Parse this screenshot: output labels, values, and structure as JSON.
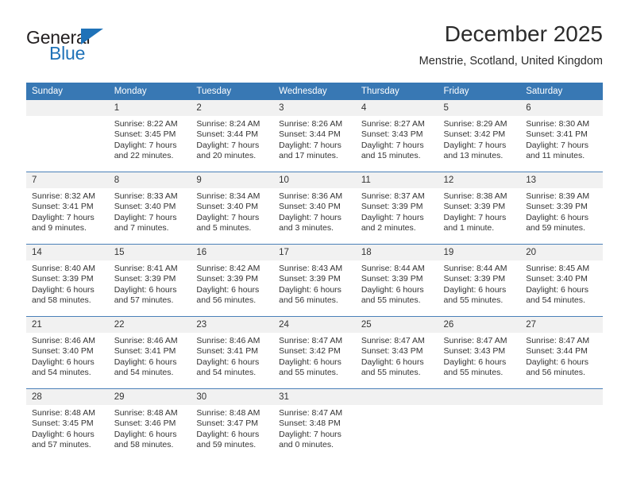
{
  "brand": {
    "name_top": "General",
    "name_bottom": "Blue",
    "triangle_icon": "triangle-icon",
    "accent_color": "#1f72b8",
    "dark_color": "#231f20"
  },
  "header": {
    "title": "December 2025",
    "subtitle": "Menstrie, Scotland, United Kingdom"
  },
  "calendar": {
    "header_bg": "#3878b4",
    "daynum_bg": "#f1f1f1",
    "weekday_headers": [
      "Sunday",
      "Monday",
      "Tuesday",
      "Wednesday",
      "Thursday",
      "Friday",
      "Saturday"
    ],
    "weeks": [
      [
        {
          "day": "",
          "lines": []
        },
        {
          "day": "1",
          "lines": [
            "Sunrise: 8:22 AM",
            "Sunset: 3:45 PM",
            "Daylight: 7 hours",
            "and 22 minutes."
          ]
        },
        {
          "day": "2",
          "lines": [
            "Sunrise: 8:24 AM",
            "Sunset: 3:44 PM",
            "Daylight: 7 hours",
            "and 20 minutes."
          ]
        },
        {
          "day": "3",
          "lines": [
            "Sunrise: 8:26 AM",
            "Sunset: 3:44 PM",
            "Daylight: 7 hours",
            "and 17 minutes."
          ]
        },
        {
          "day": "4",
          "lines": [
            "Sunrise: 8:27 AM",
            "Sunset: 3:43 PM",
            "Daylight: 7 hours",
            "and 15 minutes."
          ]
        },
        {
          "day": "5",
          "lines": [
            "Sunrise: 8:29 AM",
            "Sunset: 3:42 PM",
            "Daylight: 7 hours",
            "and 13 minutes."
          ]
        },
        {
          "day": "6",
          "lines": [
            "Sunrise: 8:30 AM",
            "Sunset: 3:41 PM",
            "Daylight: 7 hours",
            "and 11 minutes."
          ]
        }
      ],
      [
        {
          "day": "7",
          "lines": [
            "Sunrise: 8:32 AM",
            "Sunset: 3:41 PM",
            "Daylight: 7 hours",
            "and 9 minutes."
          ]
        },
        {
          "day": "8",
          "lines": [
            "Sunrise: 8:33 AM",
            "Sunset: 3:40 PM",
            "Daylight: 7 hours",
            "and 7 minutes."
          ]
        },
        {
          "day": "9",
          "lines": [
            "Sunrise: 8:34 AM",
            "Sunset: 3:40 PM",
            "Daylight: 7 hours",
            "and 5 minutes."
          ]
        },
        {
          "day": "10",
          "lines": [
            "Sunrise: 8:36 AM",
            "Sunset: 3:40 PM",
            "Daylight: 7 hours",
            "and 3 minutes."
          ]
        },
        {
          "day": "11",
          "lines": [
            "Sunrise: 8:37 AM",
            "Sunset: 3:39 PM",
            "Daylight: 7 hours",
            "and 2 minutes."
          ]
        },
        {
          "day": "12",
          "lines": [
            "Sunrise: 8:38 AM",
            "Sunset: 3:39 PM",
            "Daylight: 7 hours",
            "and 1 minute."
          ]
        },
        {
          "day": "13",
          "lines": [
            "Sunrise: 8:39 AM",
            "Sunset: 3:39 PM",
            "Daylight: 6 hours",
            "and 59 minutes."
          ]
        }
      ],
      [
        {
          "day": "14",
          "lines": [
            "Sunrise: 8:40 AM",
            "Sunset: 3:39 PM",
            "Daylight: 6 hours",
            "and 58 minutes."
          ]
        },
        {
          "day": "15",
          "lines": [
            "Sunrise: 8:41 AM",
            "Sunset: 3:39 PM",
            "Daylight: 6 hours",
            "and 57 minutes."
          ]
        },
        {
          "day": "16",
          "lines": [
            "Sunrise: 8:42 AM",
            "Sunset: 3:39 PM",
            "Daylight: 6 hours",
            "and 56 minutes."
          ]
        },
        {
          "day": "17",
          "lines": [
            "Sunrise: 8:43 AM",
            "Sunset: 3:39 PM",
            "Daylight: 6 hours",
            "and 56 minutes."
          ]
        },
        {
          "day": "18",
          "lines": [
            "Sunrise: 8:44 AM",
            "Sunset: 3:39 PM",
            "Daylight: 6 hours",
            "and 55 minutes."
          ]
        },
        {
          "day": "19",
          "lines": [
            "Sunrise: 8:44 AM",
            "Sunset: 3:39 PM",
            "Daylight: 6 hours",
            "and 55 minutes."
          ]
        },
        {
          "day": "20",
          "lines": [
            "Sunrise: 8:45 AM",
            "Sunset: 3:40 PM",
            "Daylight: 6 hours",
            "and 54 minutes."
          ]
        }
      ],
      [
        {
          "day": "21",
          "lines": [
            "Sunrise: 8:46 AM",
            "Sunset: 3:40 PM",
            "Daylight: 6 hours",
            "and 54 minutes."
          ]
        },
        {
          "day": "22",
          "lines": [
            "Sunrise: 8:46 AM",
            "Sunset: 3:41 PM",
            "Daylight: 6 hours",
            "and 54 minutes."
          ]
        },
        {
          "day": "23",
          "lines": [
            "Sunrise: 8:46 AM",
            "Sunset: 3:41 PM",
            "Daylight: 6 hours",
            "and 54 minutes."
          ]
        },
        {
          "day": "24",
          "lines": [
            "Sunrise: 8:47 AM",
            "Sunset: 3:42 PM",
            "Daylight: 6 hours",
            "and 55 minutes."
          ]
        },
        {
          "day": "25",
          "lines": [
            "Sunrise: 8:47 AM",
            "Sunset: 3:43 PM",
            "Daylight: 6 hours",
            "and 55 minutes."
          ]
        },
        {
          "day": "26",
          "lines": [
            "Sunrise: 8:47 AM",
            "Sunset: 3:43 PM",
            "Daylight: 6 hours",
            "and 55 minutes."
          ]
        },
        {
          "day": "27",
          "lines": [
            "Sunrise: 8:47 AM",
            "Sunset: 3:44 PM",
            "Daylight: 6 hours",
            "and 56 minutes."
          ]
        }
      ],
      [
        {
          "day": "28",
          "lines": [
            "Sunrise: 8:48 AM",
            "Sunset: 3:45 PM",
            "Daylight: 6 hours",
            "and 57 minutes."
          ]
        },
        {
          "day": "29",
          "lines": [
            "Sunrise: 8:48 AM",
            "Sunset: 3:46 PM",
            "Daylight: 6 hours",
            "and 58 minutes."
          ]
        },
        {
          "day": "30",
          "lines": [
            "Sunrise: 8:48 AM",
            "Sunset: 3:47 PM",
            "Daylight: 6 hours",
            "and 59 minutes."
          ]
        },
        {
          "day": "31",
          "lines": [
            "Sunrise: 8:47 AM",
            "Sunset: 3:48 PM",
            "Daylight: 7 hours",
            "and 0 minutes."
          ]
        },
        {
          "day": "",
          "lines": []
        },
        {
          "day": "",
          "lines": []
        },
        {
          "day": "",
          "lines": []
        }
      ]
    ]
  }
}
